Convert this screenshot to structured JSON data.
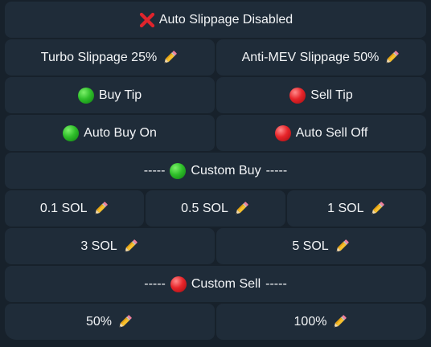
{
  "keyboard": {
    "auto_slippage": "Auto Slippage Disabled",
    "turbo_slippage": "Turbo Slippage 25%",
    "anti_mev_slippage": "Anti-MEV Slippage 50%",
    "buy_tip": "Buy Tip",
    "sell_tip": "Sell Tip",
    "auto_buy": "Auto Buy On",
    "auto_sell": "Auto Sell Off",
    "custom_buy_prefix": "-----",
    "custom_buy": "Custom Buy",
    "custom_buy_suffix": "-----",
    "buy_amounts": [
      "0.1 SOL",
      "0.5 SOL",
      "1 SOL",
      "3 SOL",
      "5 SOL"
    ],
    "custom_sell_prefix": "-----",
    "custom_sell": "Custom Sell",
    "custom_sell_suffix": "-----",
    "sell_percents": [
      "50%",
      "100%"
    ]
  },
  "icons": {
    "cross": "cross-mark-icon",
    "pencil": "pencil-icon",
    "green": "green-circle-icon",
    "red": "red-circle-icon"
  },
  "colors": {
    "background": "#17212b",
    "button": "#1f2c39",
    "text": "#f3f5f7",
    "green": "#2fbf2a",
    "red": "#e7252a"
  }
}
